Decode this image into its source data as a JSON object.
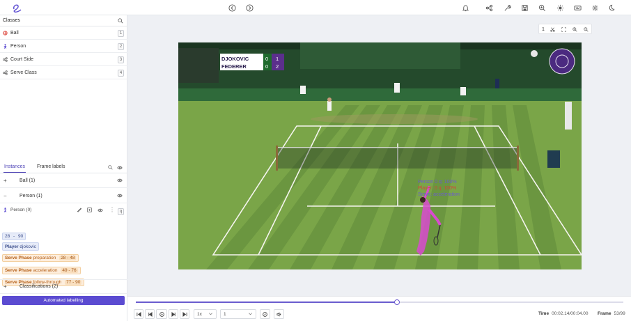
{
  "app": {
    "logo": "labellerr-logo"
  },
  "topbar": {
    "nav": [
      {
        "name": "prev-nav-icon",
        "glyph": "←"
      },
      {
        "name": "next-nav-icon",
        "glyph": "→"
      }
    ],
    "icons": [
      "bell-icon",
      "share-icon",
      "wrench-icon",
      "save-icon",
      "zoom-icon",
      "sun-icon",
      "keyboard-icon",
      "gear-icon",
      "moon-icon"
    ]
  },
  "classes": {
    "heading": "Classes",
    "items": [
      {
        "label": "Ball",
        "key": "1",
        "color": "#e0554c"
      },
      {
        "label": "Person",
        "key": "2",
        "color": "#5a4ad0"
      },
      {
        "label": "Court Side",
        "key": "3",
        "color": "#666666"
      },
      {
        "label": "Serve Class",
        "key": "4",
        "color": "#666666"
      }
    ]
  },
  "tabs": {
    "instances": "Instances",
    "frame_labels": "Frame labels"
  },
  "instances": {
    "ball": {
      "toggle": "+",
      "label": "Ball (1)"
    },
    "person": {
      "toggle": "−",
      "label": "Person (1)"
    },
    "person0": {
      "label": "Person (0)",
      "key": "q",
      "frame_start": "28",
      "frame_sep": "-",
      "frame_end": "90",
      "player_key": "Player",
      "player_value": "djokovic",
      "phases": [
        {
          "key": "Serve Phase",
          "value": "preparation",
          "start": "28",
          "end": "48"
        },
        {
          "key": "Serve Phase",
          "value": "acceleration",
          "start": "49",
          "end": "76"
        },
        {
          "key": "Serve Phase",
          "value": "follow-through",
          "start": "77",
          "end": "90"
        }
      ]
    },
    "classifications": {
      "toggle": "+",
      "label": "Classifications (2)"
    }
  },
  "automated_button": "Automated labelling",
  "video": {
    "scoreboard": [
      {
        "name": "DJOKOVIC",
        "s1": "0",
        "s2": "1"
      },
      {
        "name": "FEDERER",
        "s1": "0",
        "s2": "2"
      }
    ],
    "overlay_lines": [
      {
        "text": "Person 0 q: 100%",
        "color": "#6a5ccf"
      },
      {
        "text": "Player: 0 q: 100%",
        "color": "#d1453b"
      },
      {
        "text": "Serve: acceleration",
        "color": "#6a5ccf"
      }
    ],
    "zoom_level": "1"
  },
  "playback": {
    "progress": 0.535,
    "speed": "1x",
    "step": "1",
    "time_label": "Time",
    "time_value": "00:02.14/00:04.00",
    "frame_label": "Frame",
    "frame_value": "53/99"
  },
  "colors": {
    "accent": "#5b4bd1",
    "orange": "#f3cf9f"
  }
}
